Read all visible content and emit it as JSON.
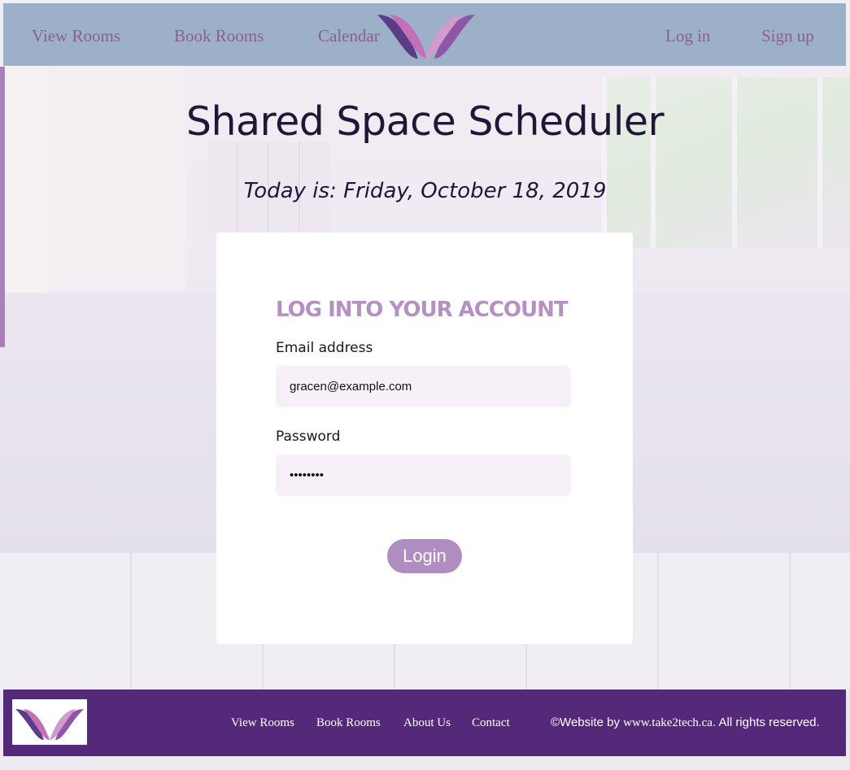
{
  "nav": {
    "view_rooms": "View Rooms",
    "book_rooms": "Book Rooms",
    "calendar": "Calendar",
    "log_in": "Log in",
    "sign_up": "Sign up"
  },
  "page": {
    "title": "Shared Space Scheduler",
    "today": "Today is: Friday, October 18, 2019"
  },
  "login_form": {
    "heading": "LOG INTO YOUR ACCOUNT",
    "email_label": "Email address",
    "email_value": "gracen@example.com",
    "password_label": "Password",
    "password_value": "••••••••",
    "submit_label": "Login"
  },
  "footer": {
    "links": [
      "View Rooms",
      "Book Rooms",
      "About Us",
      "Contact"
    ],
    "copyright_prefix": "©Website by ",
    "site": "www.take2tech.ca",
    "copyright_suffix": ". All rights reserved."
  },
  "colors": {
    "header_bg": "#9cb1c8",
    "nav_link": "#8a5f92",
    "accent": "#b08dc0",
    "footer_bg": "#55297a",
    "title": "#211638"
  },
  "icons": {
    "logo": "logo-icon"
  }
}
